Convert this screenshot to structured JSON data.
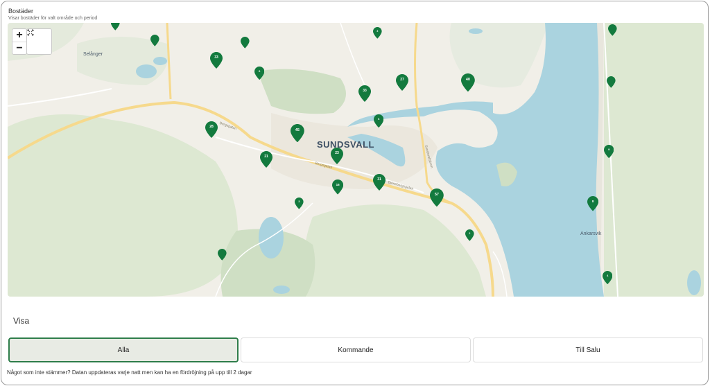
{
  "header": {
    "title": "Bostäder",
    "subtitle": "Visar bostäder för valt område och period"
  },
  "map": {
    "zoom_in": "+",
    "zoom_out": "−",
    "expand_icon": "expand-icon",
    "labels": {
      "city": "SUNDSVALL",
      "selanger": "Selånger",
      "ankarsvik": "Ankarsvik",
      "street1": "Bergsgatan",
      "street2": "Bergsgatan",
      "street3": "Bjönebergsgatan",
      "street4": "Sundsvallsbron"
    },
    "marker_color": "#137a3e",
    "markers": [
      {
        "label": "",
        "name": "marker-1"
      },
      {
        "label": "",
        "name": "marker-2"
      },
      {
        "label": "3",
        "name": "marker-3"
      },
      {
        "label": "",
        "name": "marker-4"
      },
      {
        "label": "",
        "name": "marker-5"
      },
      {
        "label": "33",
        "name": "marker-6"
      },
      {
        "label": "6",
        "name": "marker-7"
      },
      {
        "label": "27",
        "name": "marker-8"
      },
      {
        "label": "40",
        "name": "marker-9"
      },
      {
        "label": "",
        "name": "marker-10"
      },
      {
        "label": "33",
        "name": "marker-11"
      },
      {
        "label": "6",
        "name": "marker-12"
      },
      {
        "label": "28",
        "name": "marker-13"
      },
      {
        "label": "45",
        "name": "marker-14"
      },
      {
        "label": "9",
        "name": "marker-15"
      },
      {
        "label": "21",
        "name": "marker-16"
      },
      {
        "label": "23",
        "name": "marker-17"
      },
      {
        "label": "16",
        "name": "marker-18"
      },
      {
        "label": "31",
        "name": "marker-19"
      },
      {
        "label": "57",
        "name": "marker-20"
      },
      {
        "label": "8",
        "name": "marker-21"
      },
      {
        "label": "2",
        "name": "marker-22"
      },
      {
        "label": "3",
        "name": "marker-23"
      },
      {
        "label": "",
        "name": "marker-24"
      },
      {
        "label": "4",
        "name": "marker-25"
      }
    ]
  },
  "filters": {
    "heading": "Visa",
    "options": [
      "Alla",
      "Kommande",
      "Till Salu"
    ],
    "selected": "Alla"
  },
  "footer": {
    "note": "Något som inte stämmer? Datan uppdateras varje natt men kan ha en fördröjning på upp till 2 dagar"
  }
}
